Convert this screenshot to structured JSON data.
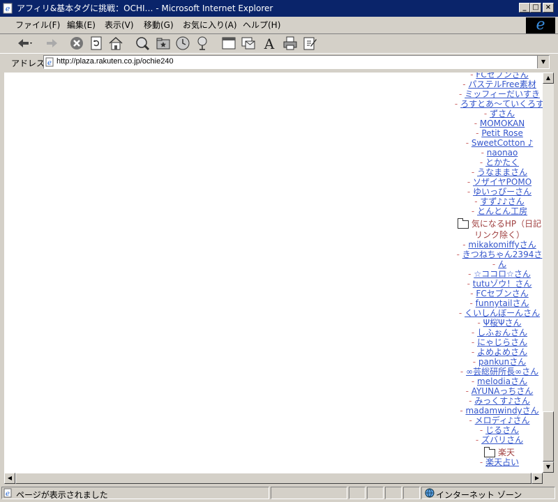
{
  "window": {
    "title": "アフィリ&基本タグに挑戦：OCHI… - Microsoft Internet Explorer",
    "controls": [
      "_",
      "□",
      "×"
    ]
  },
  "menu": [
    "ファイル(F)",
    "編集(E)",
    "表示(V)",
    "移動(G)",
    "お気に入り(A)",
    "ヘルプ(H)"
  ],
  "address": {
    "label": "アドレス",
    "url": "http://plaza.rakuten.co.jp/ochie240"
  },
  "links_top": [
    "FCセブンさん",
    "パステルFree素材",
    "ミッフィーだいすき",
    "ろすとあ～ていくろす",
    "ずさん",
    "MOMOKAN",
    "Petit Rose",
    "SweetCotton ♪",
    "naonao",
    "とかたく",
    "うなままさん",
    "ソザイヤPOMO",
    "ゆいっぴーさん",
    "すず♪♪さん",
    "とんとん工房"
  ],
  "folder1": {
    "line1": "気になるHP（日記",
    "line2": "リンク除く）"
  },
  "links_mid": [
    "mikakomiffyさん",
    "きつねちゃん2394さ",
    "ん",
    "☆ココロ☆さん",
    "tutuゾウ！さん",
    "FCセブンさん",
    "funnytailさん",
    "くいしんぼーんさん",
    "Ψ桜Ψさん",
    "しふぉんさん",
    "にゃじらさん",
    "よめよめさん",
    "pankunさん",
    "∞芸総研所長∞さん",
    "melodiaさん",
    "AYUNAっちさん",
    "みっくす♪さん",
    "madamwindyさん",
    "メロディ♪さん",
    "じるさん",
    "ズバリさん"
  ],
  "folder2": "楽天",
  "links_bottom": [
    "楽天占い"
  ],
  "status": {
    "text": "ページが表示されました",
    "zone": "インターネット ゾーン"
  }
}
